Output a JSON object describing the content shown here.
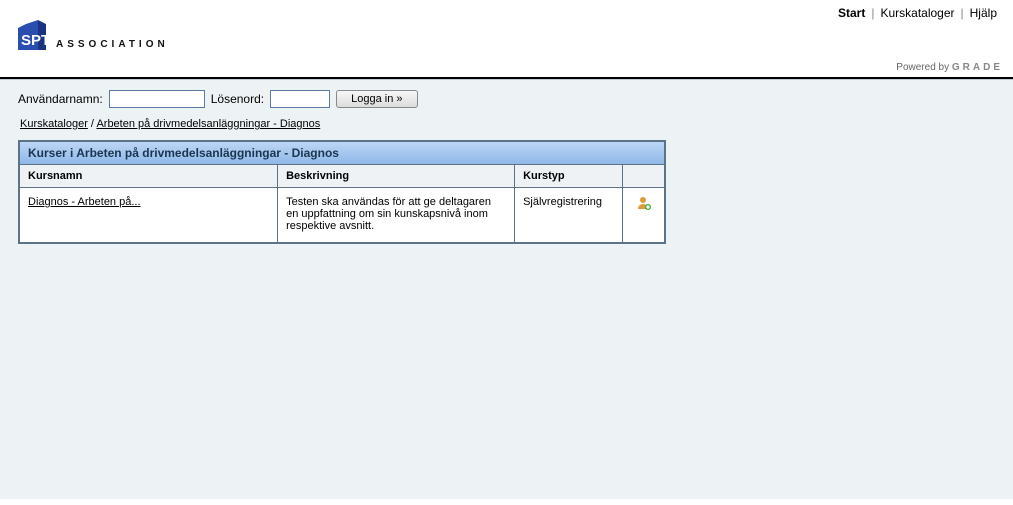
{
  "nav": {
    "items": [
      {
        "label": "Start",
        "active": true
      },
      {
        "label": "Kurskataloger",
        "active": false
      },
      {
        "label": "Hjälp",
        "active": false
      }
    ]
  },
  "logo": {
    "text": "ASSOCIATION"
  },
  "powered": {
    "prefix": "Powered by ",
    "brand": "GRADE"
  },
  "login": {
    "username_label": "Användarnamn:",
    "password_label": "Lösenord:",
    "username_value": "",
    "password_value": "",
    "button_label": "Logga in »"
  },
  "breadcrumb": {
    "items": [
      {
        "label": "Kurskataloger"
      },
      {
        "label": "Arbeten på drivmedelsanläggningar - Diagnos"
      }
    ],
    "sep": " / "
  },
  "panel": {
    "title": "Kurser i Arbeten på drivmedelsanläggningar - Diagnos",
    "columns": {
      "name": "Kursnamn",
      "desc": "Beskrivning",
      "type": "Kurstyp",
      "action": ""
    },
    "rows": [
      {
        "name": "Diagnos - Arbeten på...",
        "desc": "Testen ska användas för att ge deltagaren en uppfattning om sin kunskapsnivå inom respektive avsnitt.",
        "type": "Självregistrering",
        "action_icon": "register-user-icon"
      }
    ]
  }
}
